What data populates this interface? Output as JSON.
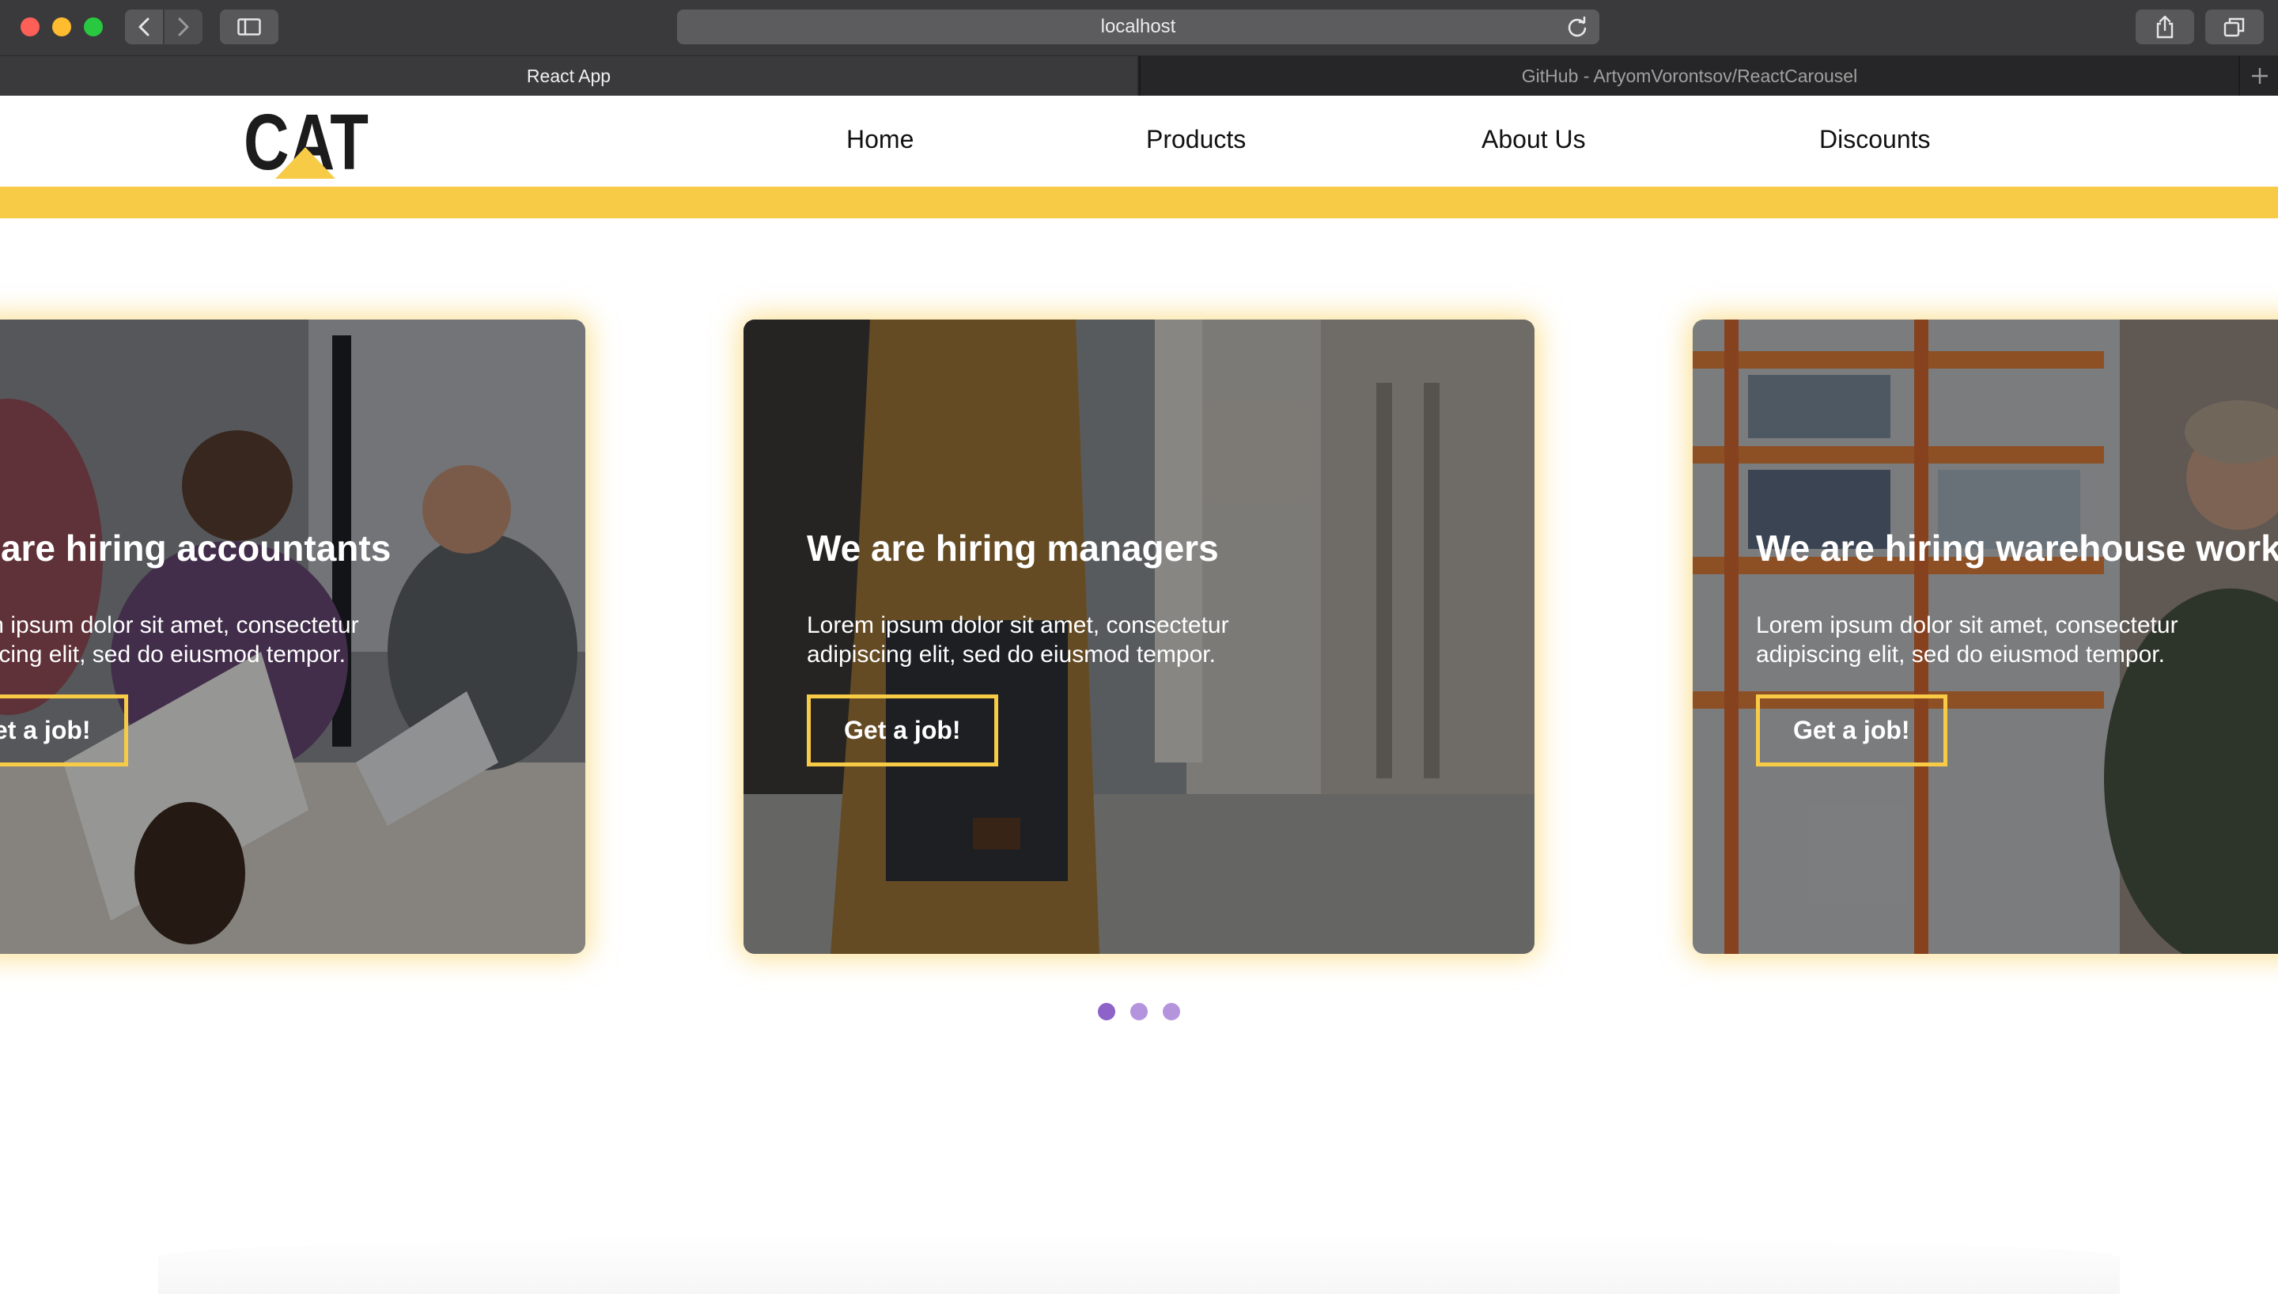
{
  "browser": {
    "url": "localhost",
    "tabs": [
      {
        "title": "React App",
        "active": true
      },
      {
        "title": "GitHub - ArtyomVorontsov/ReactCarousel",
        "active": false
      }
    ],
    "icons": [
      "back-icon",
      "forward-icon",
      "sidebar-icon",
      "reload-icon",
      "share-icon",
      "tabs-overview-icon",
      "new-tab-icon"
    ]
  },
  "site": {
    "logo_text": "CAT",
    "nav": [
      "Home",
      "Products",
      "About Us",
      "Discounts"
    ],
    "accent_color": "#f7cb46"
  },
  "carousel": {
    "slides": [
      {
        "title": "We are hiring accountants",
        "text": "Lorem ipsum dolor sit amet, consectetur adipiscing elit, sed do eiusmod tempor.",
        "button": "Get a job!"
      },
      {
        "title": "We are hiring managers",
        "text": "Lorem ipsum dolor sit amet, consectetur adipiscing elit, sed do eiusmod tempor.",
        "button": "Get a job!"
      },
      {
        "title": "We are hiring warehouse workers",
        "text": "Lorem ipsum dolor sit amet, consectetur adipiscing elit, sed do eiusmod tempor.",
        "button": "Get a job!"
      }
    ],
    "dots": 3,
    "active_dot": 0,
    "dot_colors": {
      "active": "#8d62c9",
      "inactive": "#b394dd"
    }
  }
}
